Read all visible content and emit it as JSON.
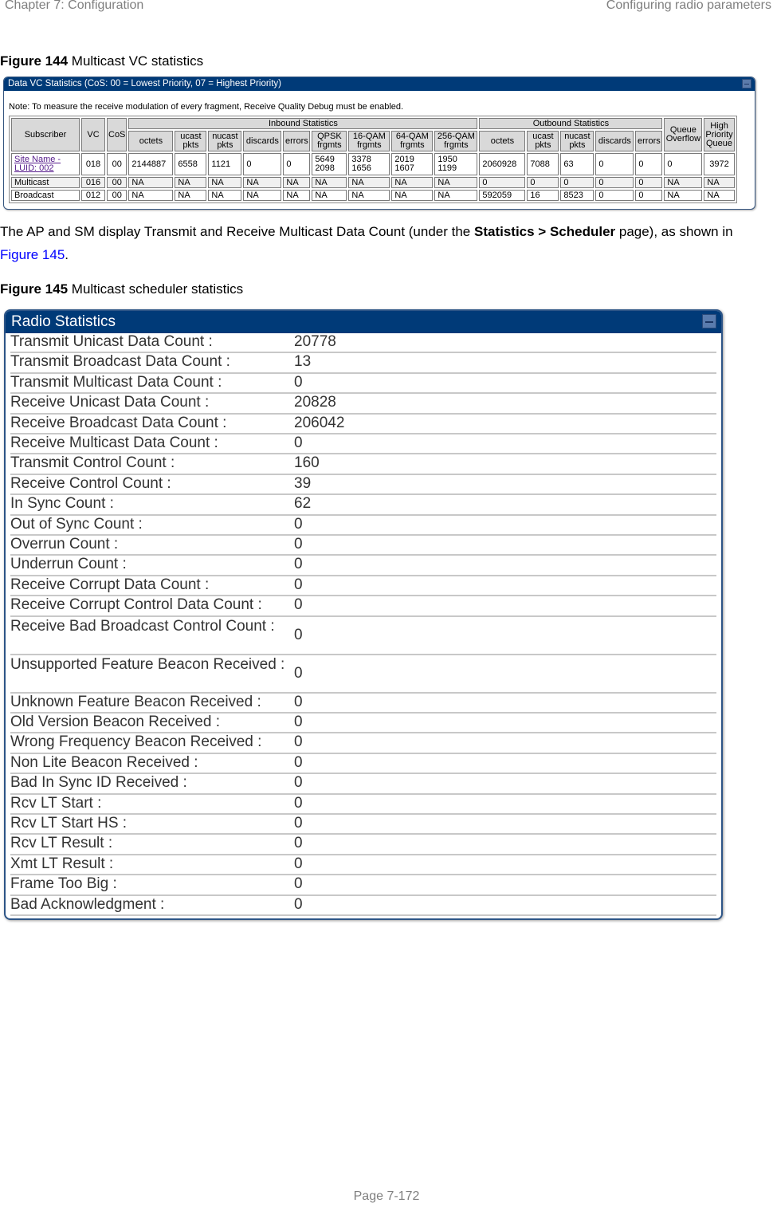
{
  "page_header": {
    "left": "Chapter 7:  Configuration",
    "right": "Configuring radio parameters"
  },
  "figure144": {
    "label": "Figure 144",
    "title": "Multicast VC statistics"
  },
  "vc_panel": {
    "title": "Data VC Statistics (CoS: 00 = Lowest Priority, 07 = Highest Priority)",
    "note": "Note: To measure the receive modulation of every fragment, Receive Quality Debug must be enabled.",
    "group_headers": {
      "subscriber": "Subscriber",
      "vc": "VC",
      "cos": "CoS",
      "inbound": "Inbound Statistics",
      "outbound": "Outbound Statistics",
      "queue_overflow": "Queue Overflow",
      "high_priority_queue": "High Priority Queue"
    },
    "inbound_columns": [
      "octets",
      "ucast pkts",
      "nucast pkts",
      "discards",
      "errors",
      "QPSK frgmts",
      "16-QAM frgmts",
      "64-QAM frgmts",
      "256-QAM frgmts"
    ],
    "outbound_columns": [
      "octets",
      "ucast pkts",
      "nucast pkts",
      "discards",
      "errors"
    ],
    "rows": [
      {
        "subscriber": "Site Name - LUID: 002",
        "vc": "018",
        "cos": "00",
        "inbound": [
          "2144887",
          "6558",
          "1121",
          "0",
          "0",
          "5649 2098",
          "3378 1656",
          "2019 1607",
          "1950 1199"
        ],
        "outbound": [
          "2060928",
          "7088",
          "63",
          "0",
          "0"
        ],
        "queue_overflow": "0",
        "high_priority_queue": "3972"
      },
      {
        "subscriber": "Multicast",
        "vc": "016",
        "cos": "00",
        "inbound": [
          "NA",
          "NA",
          "NA",
          "NA",
          "NA",
          "NA",
          "NA",
          "NA",
          "NA"
        ],
        "outbound": [
          "0",
          "0",
          "0",
          "0",
          "0"
        ],
        "queue_overflow": "NA",
        "high_priority_queue": "NA"
      },
      {
        "subscriber": "Broadcast",
        "vc": "012",
        "cos": "00",
        "inbound": [
          "NA",
          "NA",
          "NA",
          "NA",
          "NA",
          "NA",
          "NA",
          "NA",
          "NA"
        ],
        "outbound": [
          "592059",
          "16",
          "8523",
          "0",
          "0"
        ],
        "queue_overflow": "NA",
        "high_priority_queue": "NA"
      }
    ]
  },
  "paragraph": {
    "text_before": "The AP and SM display Transmit and Receive Multicast Data Count (under the ",
    "bold": "Statistics > Scheduler",
    "text_middle": " page), as shown in ",
    "link": "Figure 145",
    "text_after": "."
  },
  "figure145": {
    "label": "Figure 145",
    "title": "Multicast scheduler statistics"
  },
  "radio_panel": {
    "title": "Radio Statistics",
    "rows": [
      {
        "label": "Transmit Unicast Data Count :",
        "value": "20778"
      },
      {
        "label": "Transmit Broadcast Data Count :",
        "value": "13"
      },
      {
        "label": "Transmit Multicast Data Count :",
        "value": "0"
      },
      {
        "label": "Receive Unicast Data Count :",
        "value": "20828"
      },
      {
        "label": "Receive Broadcast Data Count :",
        "value": "206042"
      },
      {
        "label": "Receive Multicast Data Count :",
        "value": "0"
      },
      {
        "label": "Transmit Control Count :",
        "value": "160"
      },
      {
        "label": "Receive Control Count :",
        "value": "39"
      },
      {
        "label": "In Sync Count :",
        "value": "62"
      },
      {
        "label": "Out of Sync Count :",
        "value": "0"
      },
      {
        "label": "Overrun Count :",
        "value": "0"
      },
      {
        "label": "Underrun Count :",
        "value": "0"
      },
      {
        "label": "Receive Corrupt Data Count :",
        "value": "0"
      },
      {
        "label": "Receive Corrupt Control Data Count :",
        "value": "0"
      },
      {
        "label": "Receive Bad Broadcast Control Count :",
        "value": "0"
      },
      {
        "label": "Unsupported Feature Beacon Received :",
        "value": "0"
      },
      {
        "label": "Unknown Feature Beacon Received :",
        "value": "0"
      },
      {
        "label": "Old Version Beacon Received :",
        "value": "0"
      },
      {
        "label": "Wrong Frequency Beacon Received :",
        "value": "0"
      },
      {
        "label": "Non Lite Beacon Received :",
        "value": "0"
      },
      {
        "label": "Bad In Sync ID Received :",
        "value": "0"
      },
      {
        "label": "Rcv LT Start :",
        "value": "0"
      },
      {
        "label": "Rcv LT Start HS :",
        "value": "0"
      },
      {
        "label": "Rcv LT Result :",
        "value": "0"
      },
      {
        "label": "Xmt LT Result :",
        "value": "0"
      },
      {
        "label": "Frame Too Big :",
        "value": "0"
      },
      {
        "label": "Bad Acknowledgment :",
        "value": "0"
      }
    ]
  },
  "footer": {
    "page": "Page 7-172"
  }
}
